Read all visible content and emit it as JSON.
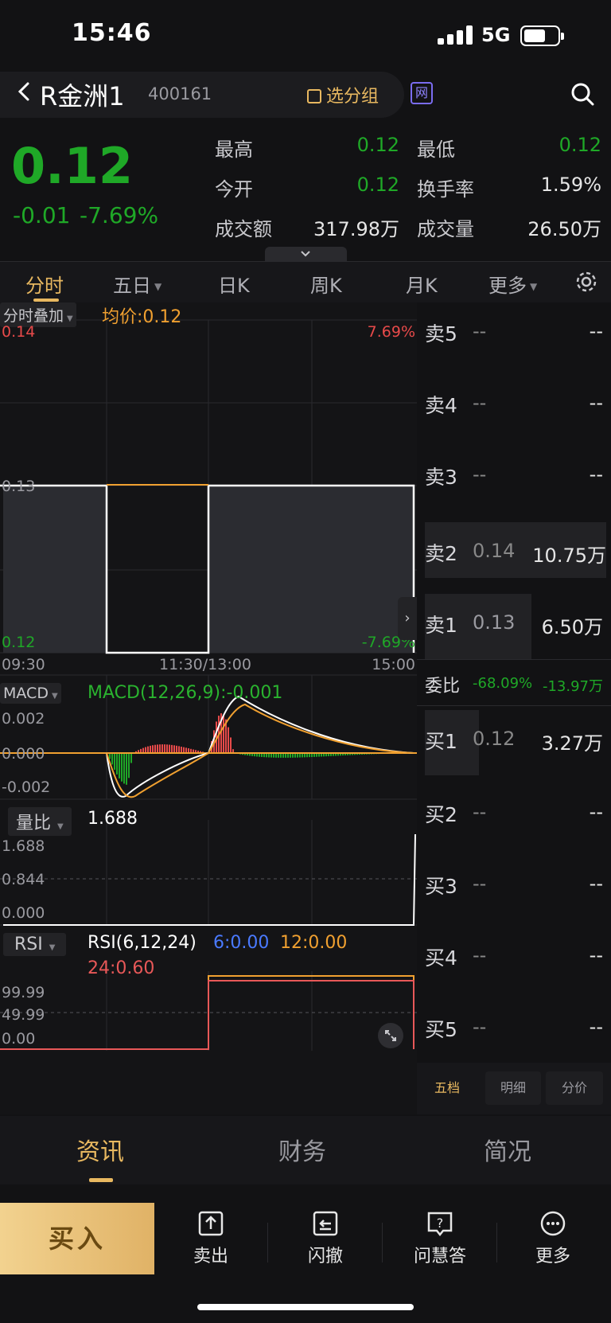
{
  "status_bar": {
    "time": "15:46",
    "network": "5G"
  },
  "header": {
    "stock_name": "R金洲1",
    "stock_code": "400161",
    "group_button": "选分组",
    "badge": "网"
  },
  "quote": {
    "price": "0.12",
    "change": "-0.01",
    "change_pct": "-7.69%",
    "stats": [
      {
        "label": "最高",
        "value": "0.12"
      },
      {
        "label": "最低",
        "value": "0.12"
      },
      {
        "label": "今开",
        "value": "0.12"
      },
      {
        "label": "换手率",
        "value": "1.59%"
      },
      {
        "label": "成交额",
        "value": "317.98万"
      },
      {
        "label": "成交量",
        "value": "26.50万"
      }
    ]
  },
  "period_tabs": [
    "分时",
    "五日",
    "日K",
    "周K",
    "月K",
    "更多"
  ],
  "chart": {
    "overlay_dropdown": "分时叠加",
    "avg_price_label": "均价:0.12",
    "price_ticks": [
      "0.14",
      "0.13",
      "0.12"
    ],
    "pct_ticks": [
      "7.69%",
      "-7.69%"
    ],
    "time_ticks": [
      "09:30",
      "11:30/13:00",
      "15:00"
    ],
    "macd_dropdown": "MACD",
    "macd_label": "MACD(12,26,9):-0.001",
    "macd_ticks": [
      "0.002",
      "0.000",
      "-0.002"
    ],
    "volratio_dropdown": "量比",
    "volratio_value": "1.688",
    "volratio_ticks": [
      "1.688",
      "0.844",
      "0.000"
    ],
    "rsi_dropdown": "RSI",
    "rsi_label": "RSI(6,12,24)",
    "rsi_6": "6:0.00",
    "rsi_12": "12:0.00",
    "rsi_24": "24:0.60",
    "rsi_ticks": [
      "99.99",
      "49.99",
      "0.00"
    ]
  },
  "order_book": {
    "asks": [
      {
        "label": "卖5",
        "price": "--",
        "volume": "--"
      },
      {
        "label": "卖4",
        "price": "--",
        "volume": "--"
      },
      {
        "label": "卖3",
        "price": "--",
        "volume": "--"
      },
      {
        "label": "卖2",
        "price": "0.14",
        "volume": "10.75万"
      },
      {
        "label": "卖1",
        "price": "0.13",
        "volume": "6.50万"
      }
    ],
    "ratio": {
      "label": "委比",
      "pct": "-68.09%",
      "diff": "-13.97万"
    },
    "bids": [
      {
        "label": "买1",
        "price": "0.12",
        "volume": "3.27万"
      },
      {
        "label": "买2",
        "price": "--",
        "volume": "--"
      },
      {
        "label": "买3",
        "price": "--",
        "volume": "--"
      },
      {
        "label": "买4",
        "price": "--",
        "volume": "--"
      },
      {
        "label": "买5",
        "price": "--",
        "volume": "--"
      }
    ],
    "tabs": [
      "五档",
      "明细",
      "分价"
    ]
  },
  "info_tabs": [
    "资讯",
    "财务",
    "简况"
  ],
  "actions": {
    "buy": "买入",
    "sell": "卖出",
    "flash_cancel": "闪撤",
    "ask": "问慧答",
    "more": "更多"
  },
  "colors": {
    "up": "#e84a4a",
    "down": "#1fa827",
    "accent": "#e8b860",
    "background": "#121214"
  }
}
